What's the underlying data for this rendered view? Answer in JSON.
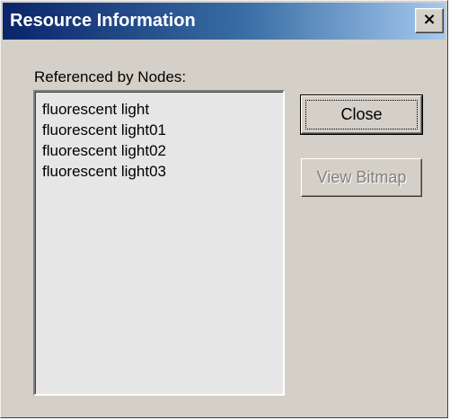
{
  "window": {
    "title": "Resource Information",
    "close_glyph": "×"
  },
  "group": {
    "label": "Referenced by Nodes:"
  },
  "nodes": [
    "fluorescent light",
    "fluorescent light01",
    "fluorescent light02",
    "fluorescent light03"
  ],
  "buttons": {
    "close_label": "Close",
    "view_bitmap_label": "View Bitmap",
    "view_bitmap_enabled": false
  },
  "colors": {
    "title_gradient_start": "#0a246a",
    "title_gradient_end": "#a6caf0",
    "dialog_face": "#d4d0c8",
    "list_background": "#e6e6e6",
    "disabled_text": "#808080"
  }
}
